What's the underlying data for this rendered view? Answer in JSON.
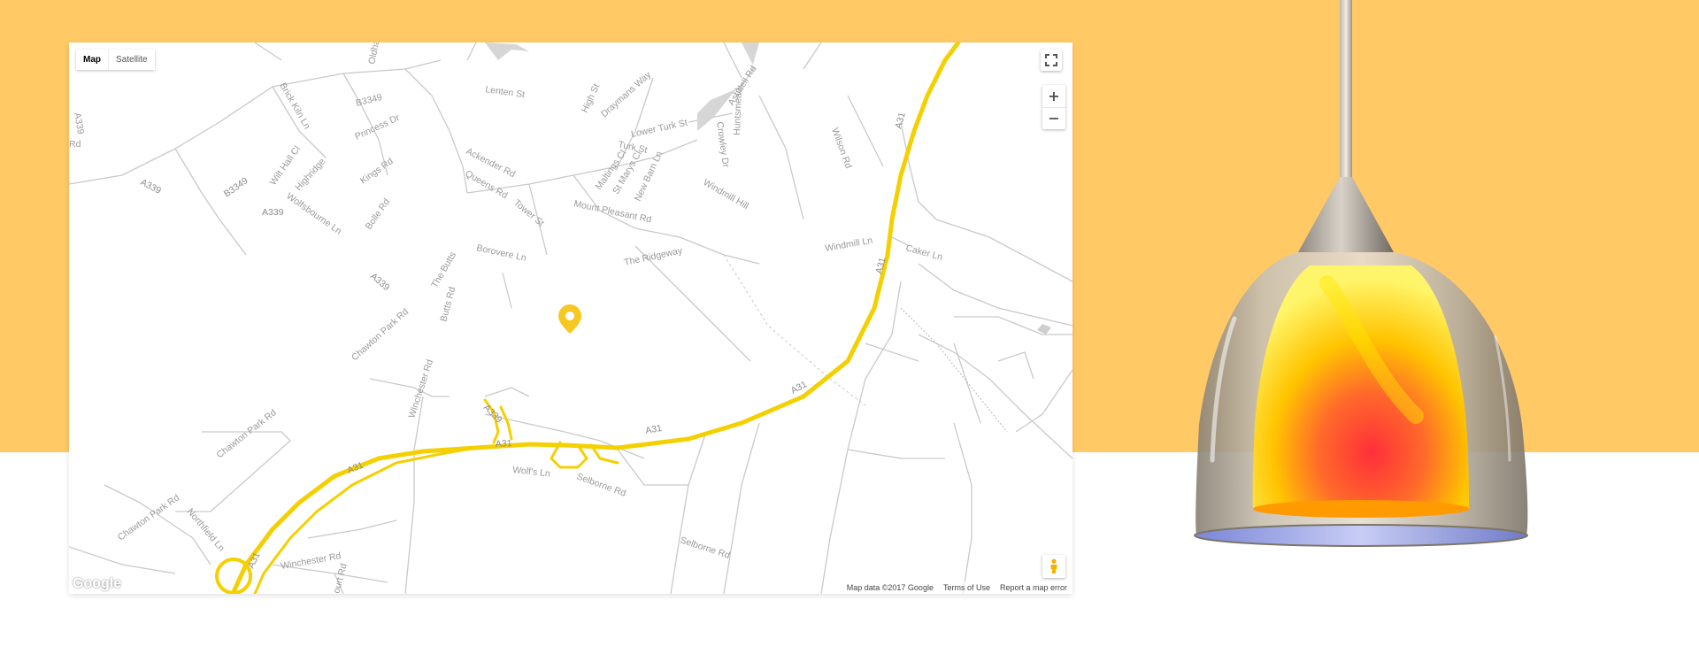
{
  "map": {
    "type_control": {
      "map_label": "Map",
      "satellite_label": "Satellite",
      "selected": "Map"
    },
    "zoom": {
      "in_label": "+",
      "out_label": "−"
    },
    "attribution": {
      "map_data": "Map data ©2017 Google",
      "terms": "Terms of Use",
      "report": "Report a map error"
    },
    "logo": "Google",
    "marker_color": "#f8c822",
    "route_color": "#f5d000",
    "labels": {
      "oldham_rd": "Oldham Rd",
      "lenten_st": "Lenten St",
      "high_st": "High St",
      "draymans_way": "Draymans Way",
      "ashdell_rd": "Ashdell Rd",
      "a339_top": "A339",
      "rd_top": "Rd",
      "b3349_top": "B3349",
      "brick_kiln": "Brick Kiln Ln",
      "princess_dr": "Princess Dr",
      "lower_turk_st": "Lower Turk St",
      "turk_st": "Turk St",
      "crowley_dr": "Crowley Dr",
      "huntsmead": "Huntsmead",
      "wilson_rd": "Wilson Rd",
      "a31_top": "A31",
      "ackender_rd": "Ackender Rd",
      "queens_rd": "Queens Rd",
      "kings_rd": "Kings Rd",
      "maltings_cl": "Maltings Cl",
      "st_marys_cl": "St Marys Cl",
      "new_barn_ln": "New Barn Ln",
      "windmill_hill": "Windmill Hill",
      "a339_left": "A339",
      "b3349_left": "B3349",
      "wilkes_hill_cl": "Wilt Hall Cl",
      "highridge": "Highridge",
      "wolfsbourne_ln": "Wolfsbourne Ln",
      "a339_mid": "A339",
      "bolle_rd": "Bolle Rd",
      "tower_st": "Tower St",
      "mount_pleasant_rd": "Mount Pleasant Rd",
      "windmill_ln": "Windmill Ln",
      "caker_ln": "Caker Ln",
      "borovere_ln": "Borovere Ln",
      "the_ridgeway": "The Ridgeway",
      "a31_mid": "A31",
      "the_butts": "The Butts",
      "a339_low": "A339",
      "butts_rd": "Butts Rd",
      "chawton_park_rd": "Chawton Park Rd",
      "winchester_rd_v": "Winchester Rd",
      "a339_ramp": "A339",
      "a31_right": "A31",
      "a31_center": "A31",
      "a31_center2": "A31",
      "chawton_park_rd_2": "Chawton Park Rd",
      "a31_left": "A31",
      "wolfs_ln": "Wolf's Ln",
      "selborne_rd": "Selborne Rd",
      "chawton_park_rd_3": "Chawton Park Rd",
      "northfield_ln": "Northfield Ln",
      "a31_bottom": "A31",
      "winchester_rd": "Winchester Rd",
      "selborne_rd_2": "Selborne Rd",
      "court_rd": "ourt Rd"
    }
  },
  "product": {
    "image": "pendant-lamp-glass-shade",
    "shade_colors": [
      "#fff200",
      "#ffb000",
      "#ff3a3a"
    ]
  }
}
